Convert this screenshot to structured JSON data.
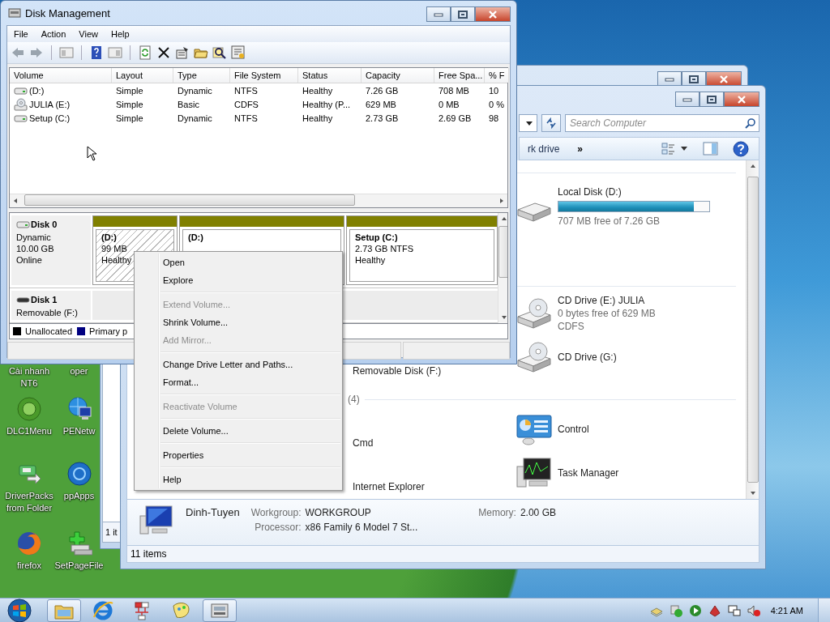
{
  "disk_management": {
    "title": "Disk Management",
    "menu": [
      "File",
      "Action",
      "View",
      "Help"
    ],
    "columns": [
      "Volume",
      "Layout",
      "Type",
      "File System",
      "Status",
      "Capacity",
      "Free Spa...",
      "% F"
    ],
    "rows": [
      {
        "kind": "disk",
        "cells": [
          "(D:)",
          "Simple",
          "Dynamic",
          "NTFS",
          "Healthy",
          "7.26 GB",
          "708 MB",
          "10"
        ]
      },
      {
        "kind": "cd",
        "cells": [
          "JULIA (E:)",
          "Simple",
          "Basic",
          "CDFS",
          "Healthy (P...",
          "629 MB",
          "0 MB",
          "0 %"
        ]
      },
      {
        "kind": "disk",
        "cells": [
          "Setup (C:)",
          "Simple",
          "Dynamic",
          "NTFS",
          "Healthy",
          "2.73 GB",
          "2.69 GB",
          "98"
        ]
      }
    ],
    "disks": [
      {
        "name": "Disk 0",
        "kind": "fixed",
        "info": [
          "Dynamic",
          "10.00 GB",
          "Online"
        ],
        "partitions": [
          {
            "label": "(D:)",
            "lines": [
              "99 MB",
              "Healthy"
            ],
            "selected": true
          },
          {
            "label": "(D:)",
            "selected": false
          },
          {
            "label": "Setup (C:)",
            "lines": [
              "2.73 GB NTFS",
              "Healthy"
            ],
            "selected": false
          }
        ]
      },
      {
        "name": "Disk 1",
        "kind": "removable",
        "info": [
          "Removable (F:)"
        ]
      }
    ],
    "legend": [
      {
        "label": "Unallocated",
        "color": "#000000"
      },
      {
        "label": "Primary p",
        "color": "#000080"
      }
    ]
  },
  "context_menu": {
    "items": [
      {
        "kind": "item",
        "label": "Open",
        "disabled": false
      },
      {
        "kind": "item",
        "label": "Explore",
        "disabled": false
      },
      {
        "kind": "separator"
      },
      {
        "kind": "item",
        "label": "Extend Volume...",
        "disabled": true
      },
      {
        "kind": "item",
        "label": "Shrink Volume...",
        "disabled": false
      },
      {
        "kind": "item",
        "label": "Add Mirror...",
        "disabled": true
      },
      {
        "kind": "separator"
      },
      {
        "kind": "item",
        "label": "Change Drive Letter and Paths...",
        "disabled": false
      },
      {
        "kind": "item",
        "label": "Format...",
        "disabled": false
      },
      {
        "kind": "separator"
      },
      {
        "kind": "item",
        "label": "Reactivate Volume",
        "disabled": true
      },
      {
        "kind": "separator"
      },
      {
        "kind": "item",
        "label": "Delete Volume...",
        "disabled": false
      },
      {
        "kind": "separator"
      },
      {
        "kind": "item",
        "label": "Properties",
        "disabled": false
      },
      {
        "kind": "separator"
      },
      {
        "kind": "item",
        "label": "Help",
        "disabled": false
      }
    ]
  },
  "back_window": {
    "status": "1 it"
  },
  "explorer": {
    "search_placeholder": "Search Computer",
    "toolbar": {
      "command": "rk drive",
      "more": "»"
    },
    "sections": [
      {
        "rows": [
          {
            "right": {
              "name": "Local Disk (D:)",
              "kind": "disk",
              "level": 0.9,
              "details": [
                "707 MB free of 7.26 GB"
              ]
            }
          }
        ]
      },
      {
        "rows": [
          {
            "right": {
              "name": "CD Drive (E:) JULIA",
              "kind": "cd",
              "details": [
                "0 bytes free of 629 MB",
                "CDFS"
              ]
            }
          },
          {
            "left": {
              "name": "Removable Disk (F:)"
            },
            "right": {
              "name": "CD Drive (G:)",
              "kind": "cd"
            }
          }
        ]
      },
      {
        "header": "(4)",
        "rows": [
          {
            "left": {
              "name": "Cmd"
            },
            "right": {
              "name": "Control",
              "kind": "control-panel"
            }
          },
          {
            "left": {
              "name": "Internet Explorer"
            },
            "right": {
              "name": "Task Manager",
              "kind": "monitor"
            }
          }
        ]
      }
    ],
    "details": {
      "computer": "Dinh-Tuyen",
      "fields": [
        {
          "label": "Workgroup:",
          "value": "WORKGROUP"
        },
        {
          "label": "Memory:",
          "value": "2.00 GB"
        },
        {
          "label": "Processor:",
          "value": "x86 Family 6 Model 7 St..."
        }
      ]
    },
    "status": "11 items"
  },
  "desktop": {
    "partial_labels": [
      "Cài nhanh NT6",
      "oper"
    ],
    "icons": [
      {
        "label": "DLC1Menu",
        "kind": "disc"
      },
      {
        "label": "PENetw",
        "kind": "network"
      },
      {
        "label": "DriverPacks from Folder",
        "kind": "driver"
      },
      {
        "label": "ppApps",
        "kind": "globe"
      },
      {
        "label": "firefox",
        "kind": "browser"
      },
      {
        "label": "SetPageFile",
        "kind": "pagefile"
      }
    ]
  },
  "taskbar": {
    "buttons": [
      {
        "kind": "folder",
        "selected": true
      },
      {
        "kind": "ie",
        "selected": false
      },
      {
        "kind": "network",
        "selected": false
      },
      {
        "kind": "paint",
        "selected": false
      },
      {
        "kind": "disk",
        "selected": true
      }
    ],
    "clock": "4:21 AM"
  }
}
